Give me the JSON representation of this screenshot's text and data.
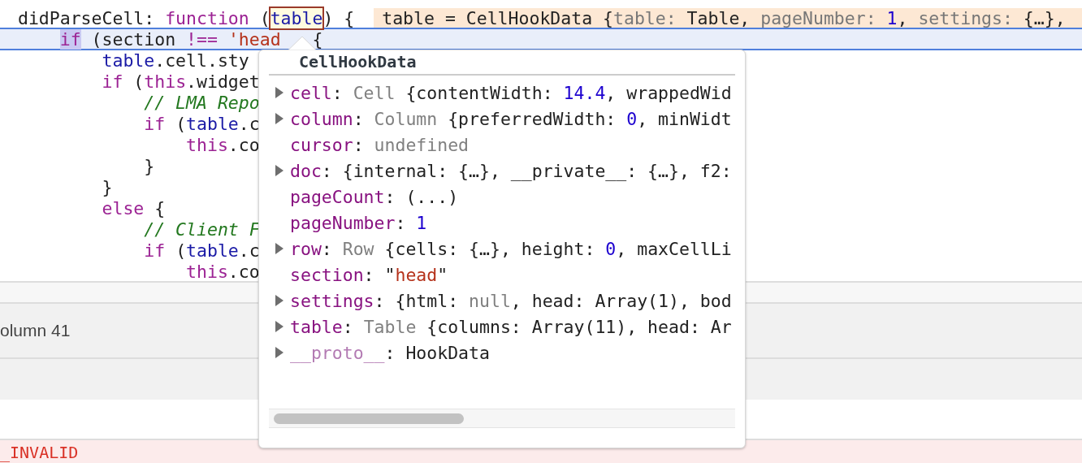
{
  "editor": {
    "lines": [
      {
        "current": false,
        "tokens": [
          {
            "text": " didParseCell: ",
            "kind": "plain"
          },
          {
            "text": "function",
            "kind": "keyword"
          },
          {
            "text": " (",
            "kind": "plain"
          },
          {
            "text": "table",
            "kind": "hovered"
          },
          {
            "text": ") {",
            "kind": "plain"
          }
        ],
        "inline_value": [
          {
            "text": "table = CellHookData {",
            "kind": "plain"
          },
          {
            "text": "table: ",
            "kind": "dim"
          },
          {
            "text": "Table, ",
            "kind": "plain"
          },
          {
            "text": "pageNumber: ",
            "kind": "dim"
          },
          {
            "text": "1",
            "kind": "number"
          },
          {
            "text": ", ",
            "kind": "plain"
          },
          {
            "text": "settings: ",
            "kind": "dim"
          },
          {
            "text": "{…},",
            "kind": "plain"
          }
        ]
      },
      {
        "current": true,
        "tokens": [
          {
            "text": "     if",
            "kind": "selected"
          },
          {
            "text": " (section ",
            "kind": "plain"
          },
          {
            "text": "!==",
            "kind": "keyword"
          },
          {
            "text": " 'head",
            "kind": "string"
          },
          {
            "text": "   {",
            "kind": "plain"
          }
        ]
      },
      {
        "current": false,
        "tokens": [
          {
            "text": "         table",
            "kind": "variable"
          },
          {
            "text": ".cell.sty",
            "kind": "plain"
          }
        ]
      },
      {
        "current": false,
        "tokens": [
          {
            "text": "         if",
            "kind": "keyword"
          },
          {
            "text": " (",
            "kind": "plain"
          },
          {
            "text": "this",
            "kind": "keyword"
          },
          {
            "text": ".widget",
            "kind": "plain"
          }
        ]
      },
      {
        "current": false,
        "tokens": [
          {
            "text": "             // LMA Repo",
            "kind": "comment"
          }
        ]
      },
      {
        "current": false,
        "tokens": [
          {
            "text": "             if",
            "kind": "keyword"
          },
          {
            "text": " (",
            "kind": "plain"
          },
          {
            "text": "table",
            "kind": "variable"
          },
          {
            "text": ".c",
            "kind": "plain"
          }
        ]
      },
      {
        "current": false,
        "tokens": [
          {
            "text": "                 this",
            "kind": "keyword"
          },
          {
            "text": ".co",
            "kind": "plain"
          }
        ]
      },
      {
        "current": false,
        "tokens": [
          {
            "text": "             }",
            "kind": "plain"
          }
        ]
      },
      {
        "current": false,
        "tokens": [
          {
            "text": "         }",
            "kind": "plain"
          }
        ]
      },
      {
        "current": false,
        "tokens": [
          {
            "text": "         else",
            "kind": "keyword"
          },
          {
            "text": " {",
            "kind": "plain"
          }
        ]
      },
      {
        "current": false,
        "tokens": [
          {
            "text": "             // Client F",
            "kind": "comment"
          }
        ]
      },
      {
        "current": false,
        "tokens": [
          {
            "text": "             if",
            "kind": "keyword"
          },
          {
            "text": " (",
            "kind": "plain"
          },
          {
            "text": "table",
            "kind": "variable"
          },
          {
            "text": ".c",
            "kind": "plain"
          }
        ]
      },
      {
        "current": false,
        "tokens": [
          {
            "text": "                 this",
            "kind": "keyword"
          },
          {
            "text": ".co",
            "kind": "plain"
          }
        ]
      }
    ]
  },
  "popover": {
    "title": "CellHookData",
    "properties": [
      {
        "expandable": true,
        "internal": false,
        "key": "cell",
        "value": [
          {
            "text": ": ",
            "kind": "plain"
          },
          {
            "text": "Cell ",
            "kind": "type"
          },
          {
            "text": "{contentWidth: ",
            "kind": "plain"
          },
          {
            "text": "14.4",
            "kind": "number"
          },
          {
            "text": ", wrappedWid",
            "kind": "plain"
          }
        ]
      },
      {
        "expandable": true,
        "internal": false,
        "key": "column",
        "value": [
          {
            "text": ": ",
            "kind": "plain"
          },
          {
            "text": "Column ",
            "kind": "type"
          },
          {
            "text": "{preferredWidth: ",
            "kind": "plain"
          },
          {
            "text": "0",
            "kind": "number"
          },
          {
            "text": ", minWidt",
            "kind": "plain"
          }
        ]
      },
      {
        "expandable": false,
        "internal": false,
        "key": "cursor",
        "value": [
          {
            "text": ": ",
            "kind": "plain"
          },
          {
            "text": "undefined",
            "kind": "type"
          }
        ]
      },
      {
        "expandable": true,
        "internal": false,
        "key": "doc",
        "value": [
          {
            "text": ": {internal: {…}, __private__: {…}, f2:",
            "kind": "plain"
          }
        ]
      },
      {
        "expandable": false,
        "internal": false,
        "key": "pageCount",
        "value": [
          {
            "text": ": (...)",
            "kind": "plain"
          }
        ]
      },
      {
        "expandable": false,
        "internal": false,
        "key": "pageNumber",
        "value": [
          {
            "text": ": ",
            "kind": "plain"
          },
          {
            "text": "1",
            "kind": "number"
          }
        ]
      },
      {
        "expandable": true,
        "internal": false,
        "key": "row",
        "value": [
          {
            "text": ": ",
            "kind": "plain"
          },
          {
            "text": "Row ",
            "kind": "type"
          },
          {
            "text": "{cells: {…}, height: ",
            "kind": "plain"
          },
          {
            "text": "0",
            "kind": "number"
          },
          {
            "text": ", maxCellLi",
            "kind": "plain"
          }
        ]
      },
      {
        "expandable": false,
        "internal": false,
        "key": "section",
        "value": [
          {
            "text": ": \"",
            "kind": "plain"
          },
          {
            "text": "head",
            "kind": "string"
          },
          {
            "text": "\"",
            "kind": "plain"
          }
        ]
      },
      {
        "expandable": true,
        "internal": false,
        "key": "settings",
        "value": [
          {
            "text": ": {html: ",
            "kind": "plain"
          },
          {
            "text": "null",
            "kind": "type"
          },
          {
            "text": ", head: Array(1), bod",
            "kind": "plain"
          }
        ]
      },
      {
        "expandable": true,
        "internal": false,
        "key": "table",
        "value": [
          {
            "text": ": ",
            "kind": "plain"
          },
          {
            "text": "Table ",
            "kind": "type"
          },
          {
            "text": "{columns: Array(11), head: Ar",
            "kind": "plain"
          }
        ]
      },
      {
        "expandable": true,
        "internal": true,
        "key": "__proto__",
        "value": [
          {
            "text": ": HookData",
            "kind": "plain"
          }
        ]
      }
    ]
  },
  "status_bar": {
    "position": "olumn 41"
  },
  "console": {
    "error": "_INVALID"
  }
}
